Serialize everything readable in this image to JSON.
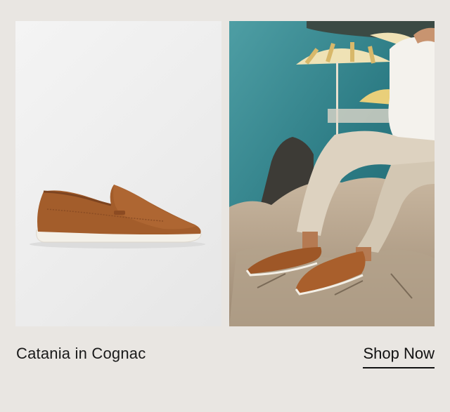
{
  "product": {
    "caption": "Catania in Cognac",
    "cta_label": "Shop Now"
  },
  "images": {
    "product_shot": "cognac-suede-loafer-icon",
    "lifestyle_shot": "seaside-lifestyle-photo"
  },
  "colors": {
    "background": "#e9e6e2",
    "cognac": "#a8612e",
    "sole": "#f4f1ea",
    "sea": "#2e7c86",
    "text": "#1a1a1a"
  }
}
